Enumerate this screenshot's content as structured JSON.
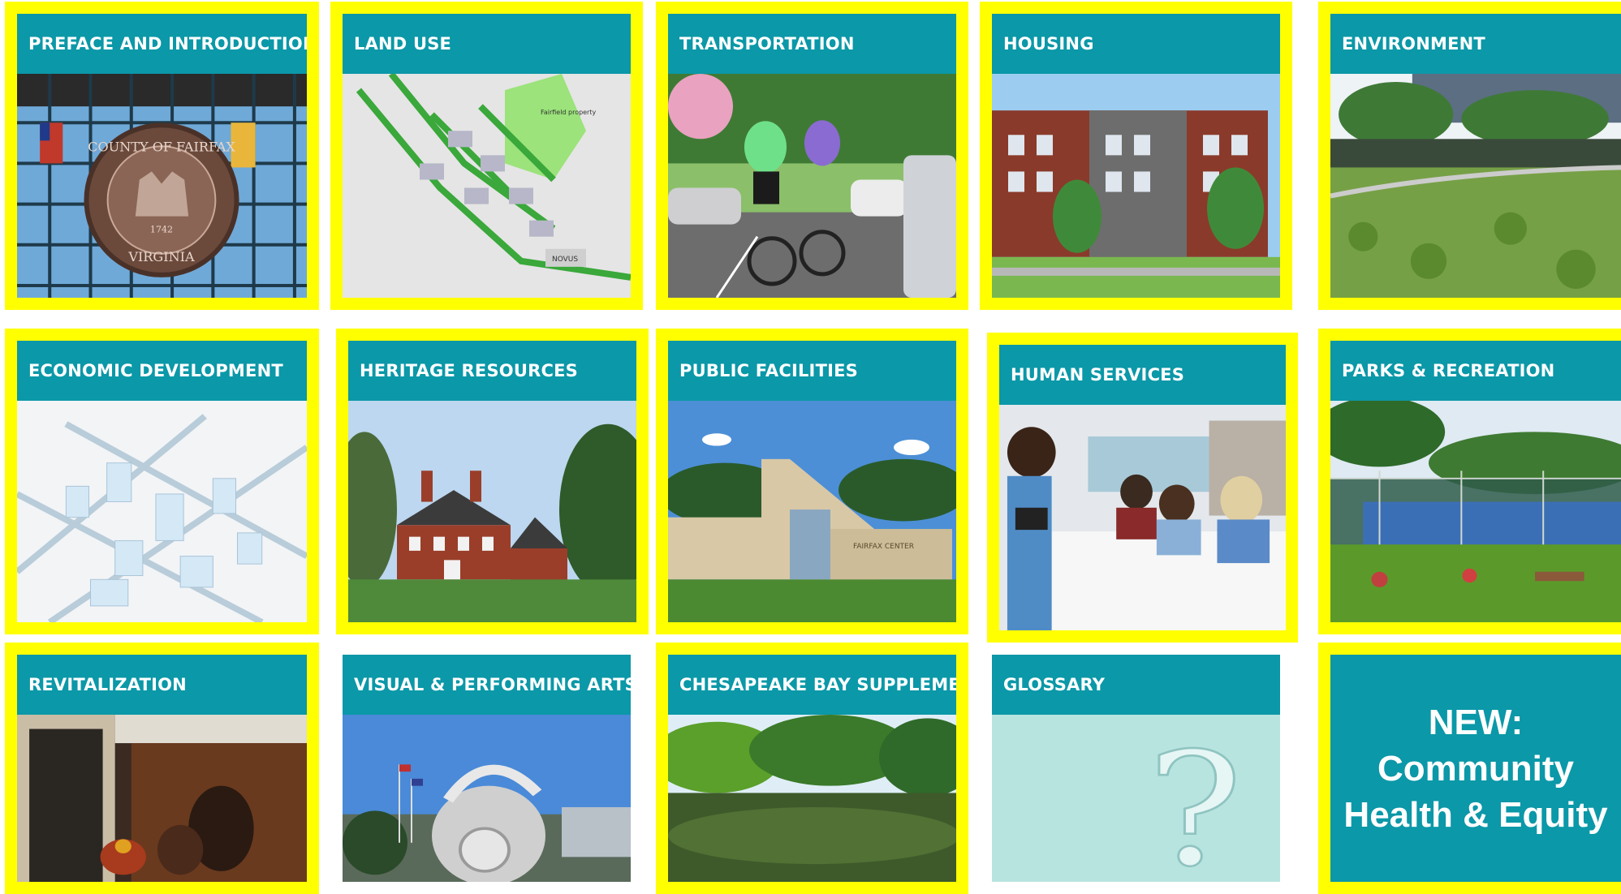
{
  "tiles": {
    "preface": "PREFACE AND INTRODUCTION",
    "land_use": "LAND USE",
    "transportation": "TRANSPORTATION",
    "housing": "HOUSING",
    "environment": "ENVIRONMENT",
    "economic": "ECONOMIC DEVELOPMENT",
    "heritage": "HERITAGE RESOURCES",
    "public_facilities": "PUBLIC FACILITIES",
    "human_services": "HUMAN SERVICES",
    "parks": "PARKS & RECREATION",
    "revitalization": "REVITALIZATION",
    "arts": "VISUAL & PERFORMING ARTS",
    "chesapeake": "CHESAPEAKE BAY SUPPLEMENT",
    "glossary": "GLOSSARY"
  },
  "photo_text": {
    "seal_top": "COUNTY OF FAIRFAX",
    "seal_bottom": "VIRGINIA",
    "seal_year": "1742",
    "map_property": "Fairfield property",
    "map_novus": "NOVUS",
    "facility_sign": "FAIRFAX CENTER"
  },
  "new_panel": {
    "line1": "NEW:",
    "line2": "Community",
    "line3": "Health & Equity"
  },
  "colors": {
    "tile_border": "#ffff00",
    "header_bg": "#0b98a8",
    "header_text": "#ffffff"
  }
}
